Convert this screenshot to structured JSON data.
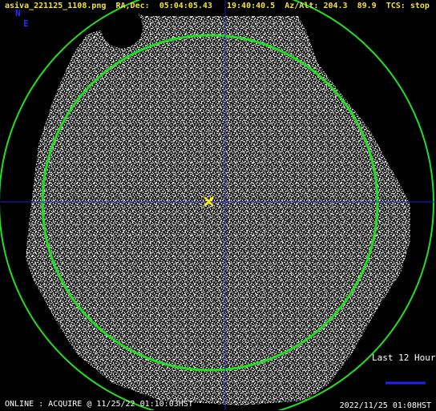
{
  "header": {
    "filename": "asiva_221125_1108.png",
    "radec_label": "RA,Dec:",
    "ra": "05:04:05.43",
    "dec": "19:40:40.5",
    "azalt_label": "Az/Alt:",
    "az": "204.3",
    "alt": "89.9",
    "tcs_label": "TCS:",
    "tcs_status": "stop"
  },
  "compass": {
    "north": "N",
    "east": "E"
  },
  "legend": {
    "label": "Last 12 Hours",
    "line_color": "#2020ff"
  },
  "footer": {
    "status_left": "ONLINE : ACQUIRE @ 11/25/22 01:10:03HST",
    "timestamp_right": "2022/11/25 01:08HST"
  },
  "colors": {
    "header_text": "#f2e33a",
    "circle": "#22dd22",
    "crosshair": "#2020cc",
    "target_marker": "#ffee00"
  },
  "icons": {
    "target": "x-marker-icon"
  }
}
